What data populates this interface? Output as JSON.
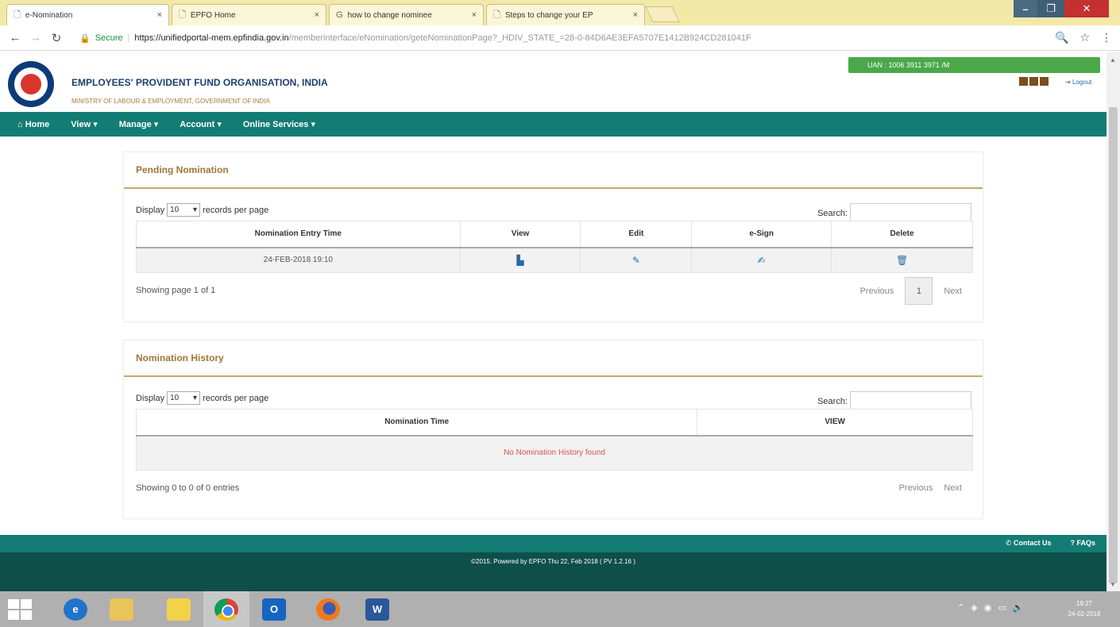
{
  "browser": {
    "tabs": [
      {
        "label": "e-Nomination",
        "close": "×"
      },
      {
        "label": "EPFO Home",
        "close": "×"
      },
      {
        "label": "how to change nominee",
        "close": "×"
      },
      {
        "label": "Steps to change your EP",
        "close": "×"
      }
    ],
    "secure_label": "Secure",
    "url_host": "https://unifiedportal-mem.epfindia.gov.in",
    "url_path": "/memberinterface/eNomination/geteNominationPage?_HDIV_STATE_=28-0-84D6AE3EFA5707E1412B924CD281041F"
  },
  "header": {
    "org_title": "EMPLOYEES' PROVIDENT FUND ORGANISATION, INDIA",
    "org_subtitle": "MINISTRY OF LABOUR & EMPLOYMENT, GOVERNMENT OF INDIA",
    "uan_label": "UAN : 1006 3911 3971 /M",
    "logout_label": "Logout"
  },
  "nav": {
    "home": "Home",
    "view": "View ▾",
    "manage": "Manage ▾",
    "account": "Account ▾",
    "online_services": "Online Services ▾"
  },
  "pending": {
    "title": "Pending Nomination",
    "display_prefix": "Display",
    "page_size": "10",
    "display_suffix": "records per page",
    "search_label": "Search:",
    "columns": [
      "Nomination Entry Time",
      "View",
      "Edit",
      "e-Sign",
      "Delete"
    ],
    "rows": [
      {
        "entry_time": "24-FEB-2018 19:10"
      }
    ],
    "showing": "Showing page 1 of 1",
    "prev": "Previous",
    "page": "1",
    "next": "Next"
  },
  "history": {
    "title": "Nomination History",
    "display_prefix": "Display",
    "page_size": "10",
    "display_suffix": "records per page",
    "search_label": "Search:",
    "columns": [
      "Nomination Time",
      "VIEW"
    ],
    "empty_message": "No Nomination History found",
    "showing": "Showing 0 to 0 of 0 entries",
    "prev": "Previous",
    "next": "Next"
  },
  "footer": {
    "contact": "Contact Us",
    "faqs": "FAQs",
    "copyright": "©2015. Powered by EPFO Thu 22, Feb 2018 ( PV 1.2.16 )"
  },
  "taskbar": {
    "time": "19:27",
    "date": "24-02-2018"
  }
}
